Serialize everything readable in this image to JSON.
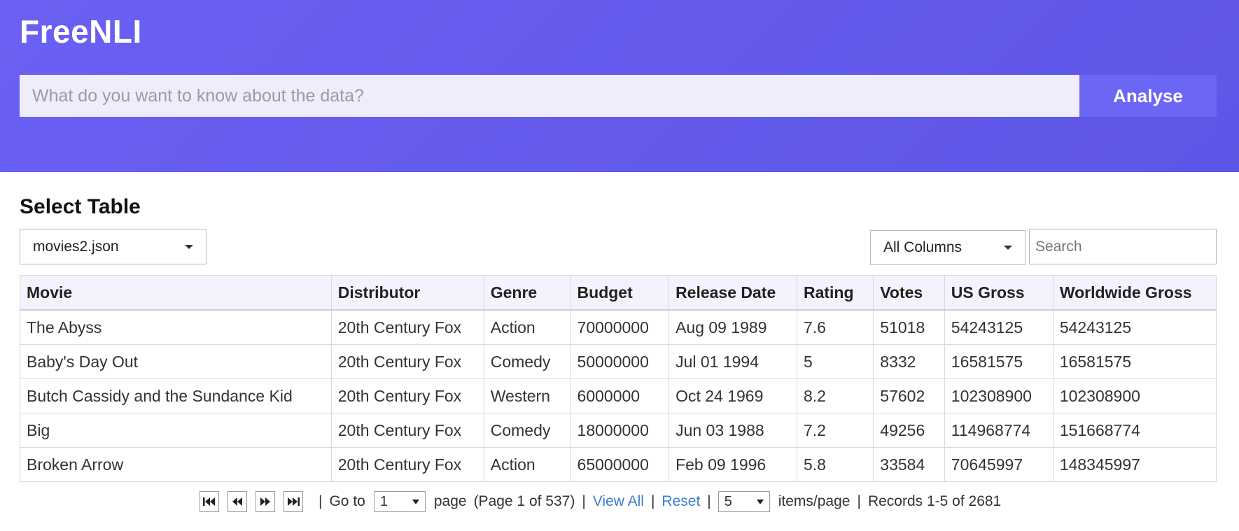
{
  "app": {
    "title": "FreeNLI"
  },
  "query": {
    "placeholder": "What do you want to know about the data?",
    "value": "",
    "submit_label": "Analyse"
  },
  "table_section": {
    "title": "Select Table",
    "selected_table": "movies2.json",
    "column_filter": "All Columns",
    "search_placeholder": "Search"
  },
  "grid": {
    "columns": [
      "Movie",
      "Distributor",
      "Genre",
      "Budget",
      "Release Date",
      "Rating",
      "Votes",
      "US Gross",
      "Worldwide Gross"
    ],
    "rows": [
      [
        "The Abyss",
        "20th Century Fox",
        "Action",
        "70000000",
        "Aug 09 1989",
        "7.6",
        "51018",
        "54243125",
        "54243125"
      ],
      [
        "Baby's Day Out",
        "20th Century Fox",
        "Comedy",
        "50000000",
        "Jul 01 1994",
        "5",
        "8332",
        "16581575",
        "16581575"
      ],
      [
        "Butch Cassidy and the Sundance Kid",
        "20th Century Fox",
        "Western",
        "6000000",
        "Oct 24 1969",
        "8.2",
        "57602",
        "102308900",
        "102308900"
      ],
      [
        "Big",
        "20th Century Fox",
        "Comedy",
        "18000000",
        "Jun 03 1988",
        "7.2",
        "49256",
        "114968774",
        "151668774"
      ],
      [
        "Broken Arrow",
        "20th Century Fox",
        "Action",
        "65000000",
        "Feb 09 1996",
        "5.8",
        "33584",
        "70645997",
        "148345997"
      ]
    ]
  },
  "pagination": {
    "goto_label": "Go to",
    "current_page": "1",
    "page_label": "page",
    "page_info": "(Page 1 of 537)",
    "view_all": "View All",
    "reset": "Reset",
    "items_per_page": "5",
    "items_label": "items/page",
    "records": "Records 1-5 of 2681",
    "separator": "|"
  },
  "icons": {
    "first": "first-page-icon",
    "prev": "previous-page-icon",
    "next": "next-page-icon",
    "last": "last-page-icon"
  }
}
